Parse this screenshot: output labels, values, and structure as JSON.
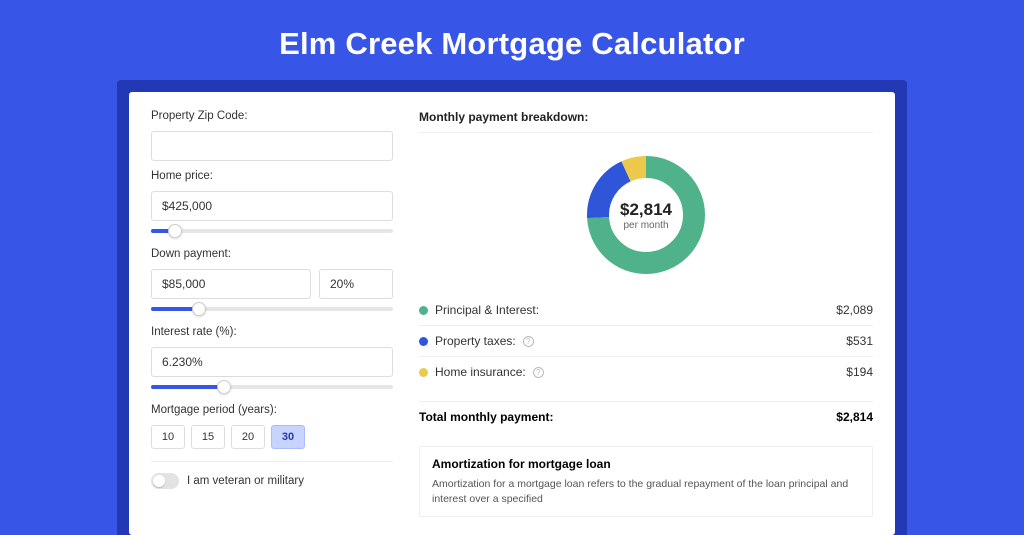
{
  "hero": {
    "title": "Elm Creek Mortgage Calculator"
  },
  "form": {
    "zip_label": "Property Zip Code:",
    "zip_value": "",
    "home_price_label": "Home price:",
    "home_price_value": "$425,000",
    "home_price_slider_pct": 10,
    "down_payment_label": "Down payment:",
    "down_payment_value": "$85,000",
    "down_payment_pct_value": "20%",
    "down_payment_slider_pct": 20,
    "interest_label": "Interest rate (%):",
    "interest_value": "6.230%",
    "interest_slider_pct": 30,
    "period_label": "Mortgage period (years):",
    "periods": [
      "10",
      "15",
      "20",
      "30"
    ],
    "period_active": "30",
    "veteran_label": "I am veteran or military"
  },
  "breakdown": {
    "title": "Monthly payment breakdown:",
    "center_amount": "$2,814",
    "center_label": "per month",
    "items": [
      {
        "label": "Principal & Interest:",
        "value": "$2,089",
        "color": "#4fb28a",
        "pct": 74,
        "info": false
      },
      {
        "label": "Property taxes:",
        "value": "$531",
        "color": "#2f56d9",
        "pct": 19,
        "info": true
      },
      {
        "label": "Home insurance:",
        "value": "$194",
        "color": "#ecc94b",
        "pct": 7,
        "info": true
      }
    ],
    "total_label": "Total monthly payment:",
    "total_value": "$2,814"
  },
  "amortization": {
    "title": "Amortization for mortgage loan",
    "text": "Amortization for a mortgage loan refers to the gradual repayment of the loan principal and interest over a specified"
  },
  "chart_data": {
    "type": "pie",
    "title": "Monthly payment breakdown",
    "series": [
      {
        "name": "Principal & Interest",
        "value": 2089
      },
      {
        "name": "Property taxes",
        "value": 531
      },
      {
        "name": "Home insurance",
        "value": 194
      }
    ],
    "total": 2814,
    "unit": "USD per month"
  }
}
